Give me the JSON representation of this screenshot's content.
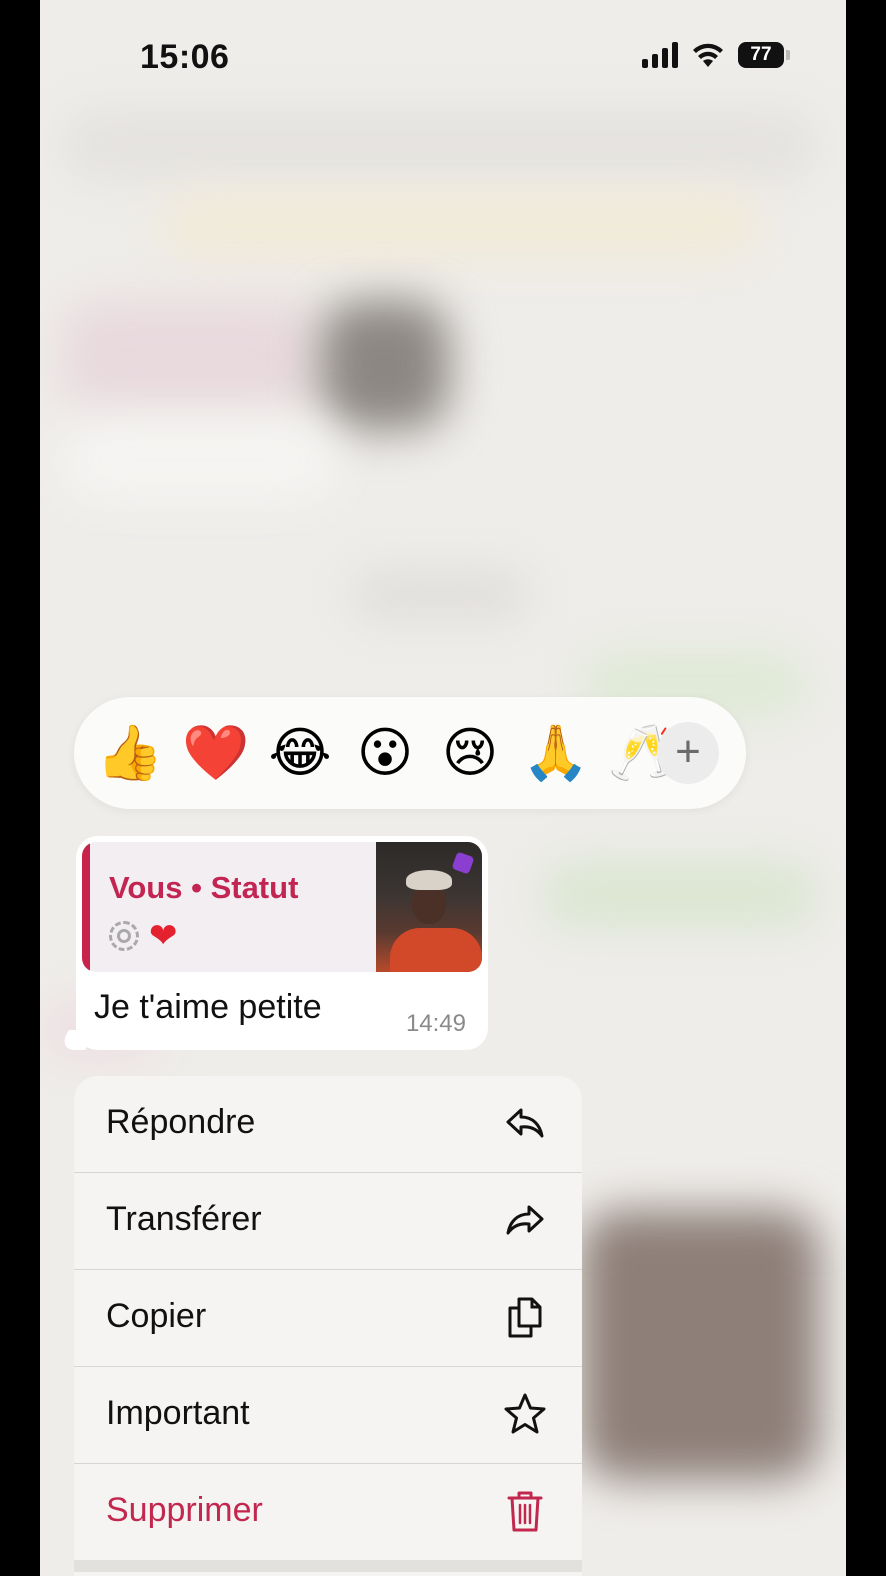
{
  "status_bar": {
    "time": "15:06",
    "battery": "77"
  },
  "reactions": {
    "emojis": [
      "👍",
      "❤️",
      "😂",
      "😮",
      "😢",
      "🙏",
      "🥂"
    ],
    "more": "+"
  },
  "message": {
    "quote_title": "Vous • Statut",
    "quote_reaction": "❤",
    "text": "Je t'aime petite",
    "time": "14:49"
  },
  "menu": {
    "items": [
      {
        "label": "Répondre",
        "icon": "reply-icon"
      },
      {
        "label": "Transférer",
        "icon": "forward-icon"
      },
      {
        "label": "Copier",
        "icon": "copy-icon"
      },
      {
        "label": "Important",
        "icon": "star-icon"
      },
      {
        "label": "Supprimer",
        "icon": "trash-icon"
      }
    ]
  },
  "colors": {
    "accent_red": "#c2274e",
    "background": "#efedea"
  }
}
